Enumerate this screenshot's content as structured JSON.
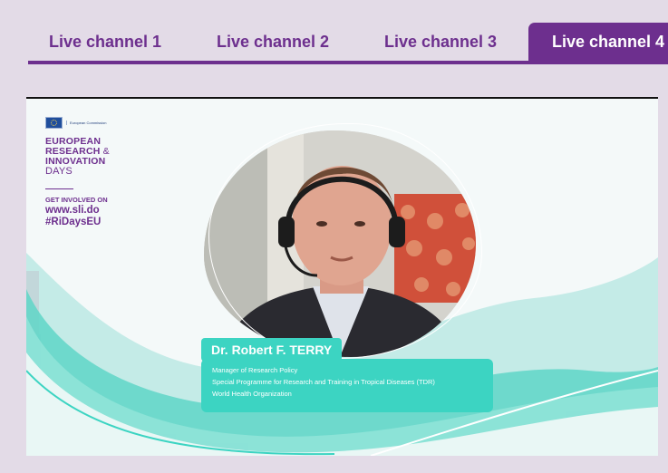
{
  "tabs": [
    {
      "label": "Live channel 1",
      "active": false
    },
    {
      "label": "Live channel 2",
      "active": false
    },
    {
      "label": "Live channel 3",
      "active": false
    },
    {
      "label": "Live channel 4",
      "active": true
    }
  ],
  "colors": {
    "brand_purple": "#6d2f8e",
    "page_background": "#e3dbe7",
    "teal_accent": "#3cd4c2"
  },
  "video": {
    "logo": {
      "commission_text": "European Commission",
      "event_name_line1": "EUROPEAN",
      "event_name_line2": "RESEARCH",
      "event_name_amp": "&",
      "event_name_line3": "INNOVATION",
      "event_name_line4": "DAYS",
      "get_involved": "GET INVOLVED ON",
      "slido_url": "www.sli.do",
      "hashtag": "#RiDaysEU"
    },
    "speaker": {
      "name": "Dr. Robert F. TERRY",
      "role_line1": "Manager of Research Policy",
      "role_line2": "Special Programme for Research and Training in Tropical Diseases (TDR)",
      "role_line3": "World Health Organization"
    }
  }
}
